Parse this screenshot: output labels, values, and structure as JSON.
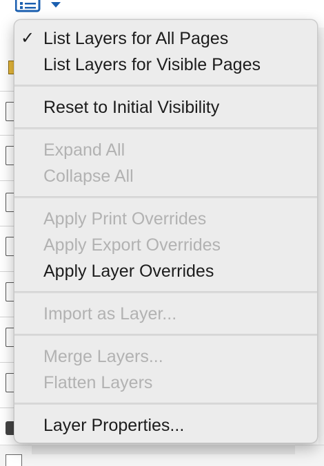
{
  "toolbar": {
    "list_icon": "list-icon",
    "chevron_icon": "chevron-down-icon",
    "icon_color": "#1b5fb0"
  },
  "menu": {
    "items": [
      {
        "label": "List Layers for All Pages",
        "enabled": true,
        "checked": true
      },
      {
        "label": "List Layers for Visible Pages",
        "enabled": true,
        "checked": false
      },
      {
        "label": "Reset to Initial Visibility",
        "enabled": true,
        "checked": false
      },
      {
        "label": "Expand All",
        "enabled": false,
        "checked": false
      },
      {
        "label": "Collapse All",
        "enabled": false,
        "checked": false
      },
      {
        "label": "Apply Print Overrides",
        "enabled": false,
        "checked": false
      },
      {
        "label": "Apply Export Overrides",
        "enabled": false,
        "checked": false
      },
      {
        "label": "Apply Layer Overrides",
        "enabled": true,
        "checked": false
      },
      {
        "label": "Import as Layer...",
        "enabled": false,
        "checked": false
      },
      {
        "label": "Merge Layers...",
        "enabled": false,
        "checked": false
      },
      {
        "label": "Flatten Layers",
        "enabled": false,
        "checked": false
      },
      {
        "label": "Layer Properties...",
        "enabled": true,
        "checked": false
      }
    ],
    "checkmark": "✓",
    "enabled_color": "#1c1c1c",
    "disabled_color": "#b2b2b2"
  }
}
